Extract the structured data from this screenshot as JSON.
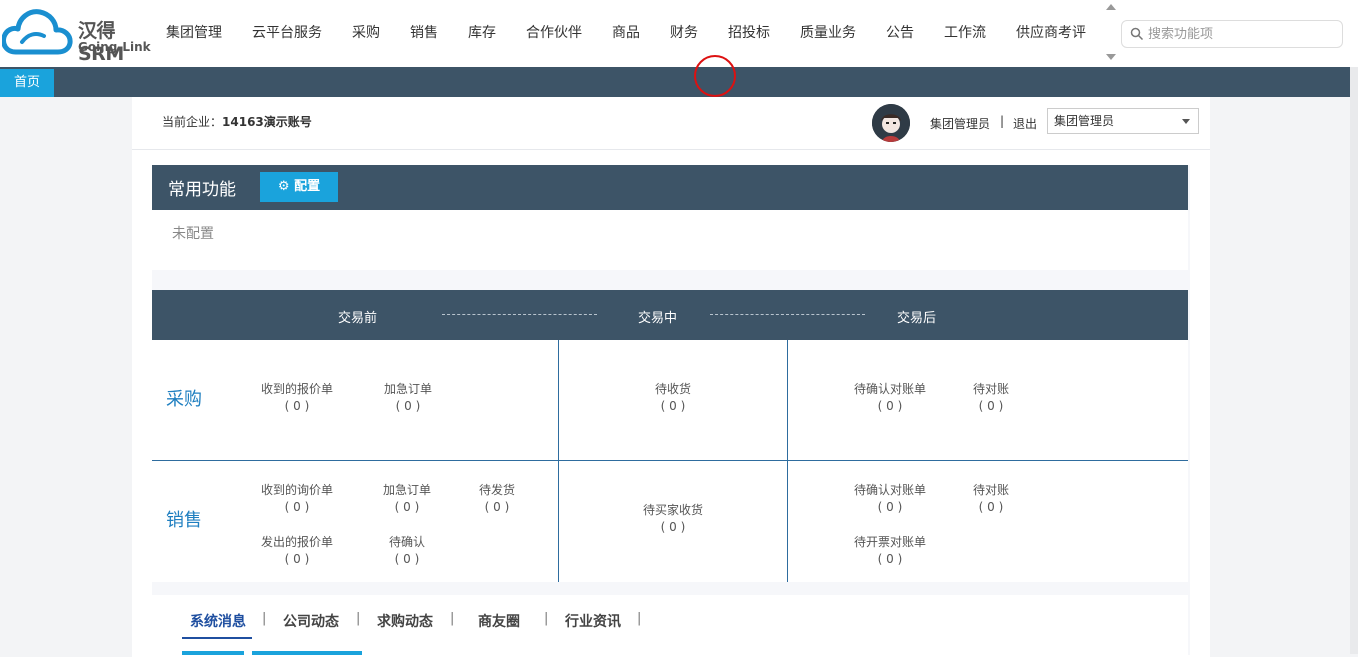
{
  "logo": {
    "brand": "汉得SRM",
    "sub": "Going-Link"
  },
  "nav": {
    "items": [
      "集团管理",
      "云平台服务",
      "采购",
      "销售",
      "库存",
      "合作伙伴",
      "商品",
      "财务",
      "招投标",
      "质量业务",
      "公告",
      "工作流",
      "供应商考评"
    ]
  },
  "search": {
    "placeholder": "搜索功能项"
  },
  "tabs": {
    "home": "首页"
  },
  "header": {
    "company_label": "当前企业：",
    "company_name": "14163演示账号",
    "user_role": "集团管理员",
    "separator": "|",
    "logout": "退出",
    "role_selected": "集团管理员"
  },
  "common": {
    "title": "常用功能",
    "config_button": "配置",
    "empty_text": "未配置"
  },
  "flow": {
    "before": "交易前",
    "during": "交易中",
    "after": "交易后"
  },
  "purchase": {
    "title": "采购",
    "before": [
      {
        "label": "收到的报价单",
        "count": "( 0 )"
      },
      {
        "label": "加急订单",
        "count": "( 0 )"
      }
    ],
    "during": [
      {
        "label": "待收货",
        "count": "( 0 )"
      }
    ],
    "after": [
      {
        "label": "待确认对账单",
        "count": "( 0 )"
      },
      {
        "label": "待对账",
        "count": "( 0 )"
      }
    ]
  },
  "sales": {
    "title": "销售",
    "before": [
      {
        "label": "收到的询价单",
        "count": "( 0 )"
      },
      {
        "label": "加急订单",
        "count": "( 0 )"
      },
      {
        "label": "待发货",
        "count": "( 0 )"
      },
      {
        "label": "发出的报价单",
        "count": "( 0 )"
      },
      {
        "label": "待确认",
        "count": "( 0 )"
      }
    ],
    "during": [
      {
        "label": "待买家收货",
        "count": "( 0 )"
      }
    ],
    "after": [
      {
        "label": "待确认对账单",
        "count": "( 0 )"
      },
      {
        "label": "待对账",
        "count": "( 0 )"
      },
      {
        "label": "待开票对账单",
        "count": "( 0 )"
      }
    ]
  },
  "news": {
    "tabs": [
      "系统消息",
      "公司动态",
      "求购动态",
      "商友圈",
      "行业资讯"
    ],
    "separator": "|"
  },
  "colors": {
    "header_dark": "#3d5467",
    "accent_blue": "#1aa3dc",
    "link_blue": "#1f7fc0"
  }
}
